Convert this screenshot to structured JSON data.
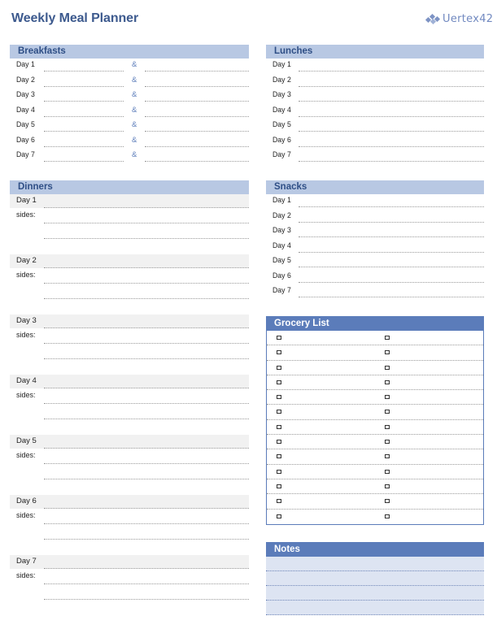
{
  "header": {
    "title": "Weekly Meal Planner",
    "logo_text": "Uertex42",
    "logo_icon": "vertex42-logo-icon"
  },
  "colors": {
    "title": "#3d5a8e",
    "light_header": "#b8c8e3",
    "dark_header": "#5b7cba",
    "notes_bg": "#dde4f2",
    "day_band": "#f1f1f1"
  },
  "breakfasts": {
    "title": "Breakfasts",
    "separator": "&",
    "days": [
      "Day 1",
      "Day 2",
      "Day 3",
      "Day 4",
      "Day 5",
      "Day 6",
      "Day 7"
    ]
  },
  "lunches": {
    "title": "Lunches",
    "days": [
      "Day 1",
      "Day 2",
      "Day 3",
      "Day 4",
      "Day 5",
      "Day 6",
      "Day 7"
    ]
  },
  "dinners": {
    "title": "Dinners",
    "sides_label": "sides:",
    "days": [
      "Day 1",
      "Day 2",
      "Day 3",
      "Day 4",
      "Day 5",
      "Day 6",
      "Day 7"
    ]
  },
  "snacks": {
    "title": "Snacks",
    "days": [
      "Day 1",
      "Day 2",
      "Day 3",
      "Day 4",
      "Day 5",
      "Day 6",
      "Day 7"
    ]
  },
  "grocery": {
    "title": "Grocery List",
    "rows": 13,
    "columns": 2,
    "checkbox_icon": "checkbox-icon"
  },
  "notes": {
    "title": "Notes",
    "lines": 4
  }
}
